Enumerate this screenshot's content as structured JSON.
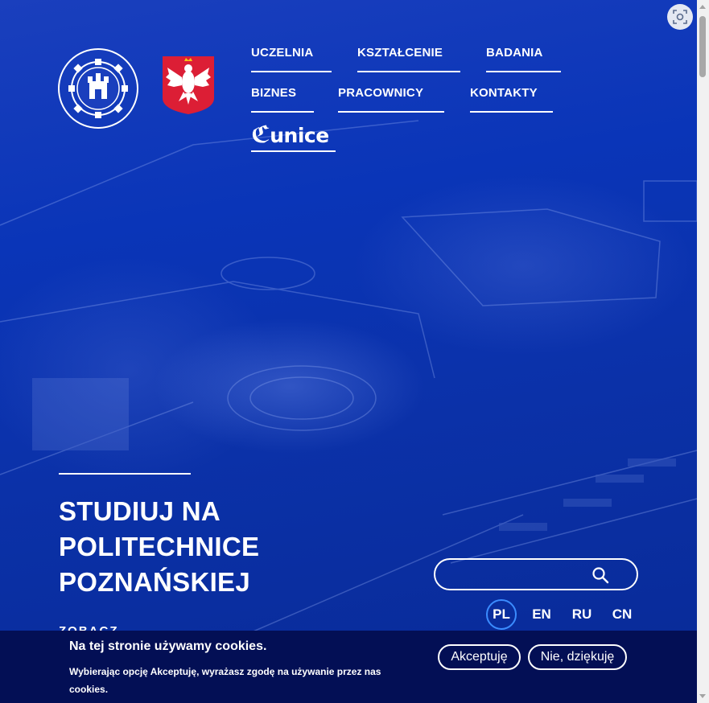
{
  "header": {
    "logo_alt": "POLITECHNIKA POZNAŃSKA · POZNAN UNIVERSITY OF TECHNOLOGY",
    "nav": [
      {
        "label": "UCZELNIA"
      },
      {
        "label": "KSZTAŁCENIE"
      },
      {
        "label": "BADANIA"
      },
      {
        "label": "BIZNES"
      },
      {
        "label": "PRACOWNICY"
      },
      {
        "label": "KONTAKTY"
      },
      {
        "label": "unice"
      }
    ]
  },
  "hero": {
    "title": "STUDIUJ NA POLITECHNICE POZNAŃSKIEJ",
    "subtitle": "ZOBACZ"
  },
  "search": {
    "value": "",
    "placeholder": ""
  },
  "languages": [
    {
      "code": "PL",
      "active": true
    },
    {
      "code": "EN",
      "active": false
    },
    {
      "code": "RU",
      "active": false
    },
    {
      "code": "CN",
      "active": false
    }
  ],
  "cookie": {
    "title": "Na tej stronie używamy cookies.",
    "text": "Wybierając opcję Akceptuję, wyrażasz zgodę na używanie przez nas cookies.",
    "accept_label": "Akceptuję",
    "decline_label": "Nie, dziękuję"
  },
  "colors": {
    "hero_tint": "#0b31a8",
    "cookie_bg": "#030f55",
    "active_lang_ring": "#3b8cff"
  },
  "icons": {
    "accessibility": "focus-scan-icon",
    "search": "search-icon"
  }
}
